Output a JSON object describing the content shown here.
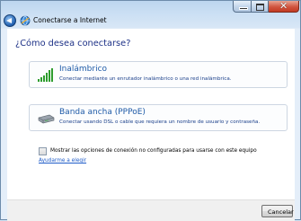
{
  "window": {
    "title": "Conectarse a Internet",
    "controls": {
      "minimize": "",
      "maximize": "",
      "close": "✕"
    }
  },
  "page": {
    "heading": "¿Cómo desea conectarse?"
  },
  "options": [
    {
      "title": "Inalámbrico",
      "description": "Conectar mediante un enrutador inalámbrico o una red inalámbrica.",
      "icon": "wireless-signal-icon"
    },
    {
      "title": "Banda ancha (PPPoE)",
      "description": "Conectar usando DSL o cable que requiera un nombre de usuario y contraseña.",
      "icon": "modem-icon"
    }
  ],
  "checkbox": {
    "label": "Mostrar las opciones de conexión no configuradas para usarse con este equipo",
    "checked": false
  },
  "help_link": "Ayudarme a elegir",
  "footer": {
    "cancel_label": "Cancelar"
  },
  "colors": {
    "heading": "#1e3287",
    "option_title": "#1f5ba7",
    "link": "#1f5cc8",
    "close_button": "#c23a22"
  }
}
